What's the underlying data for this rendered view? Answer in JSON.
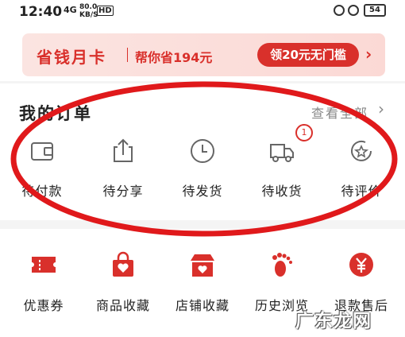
{
  "status_bar": {
    "time": "12:40",
    "network": "4G",
    "speed_value": "80.0",
    "speed_unit": "KB/S",
    "hd": "HD",
    "battery": "54"
  },
  "promo": {
    "title": "省钱月卡",
    "subtitle": "帮你省194元",
    "button": "领20元无门槛",
    "arrow": "›"
  },
  "orders": {
    "title": "我的订单",
    "view_all": "查看全部",
    "items": [
      {
        "label": "待付款",
        "icon": "wallet-icon"
      },
      {
        "label": "待分享",
        "icon": "share-icon"
      },
      {
        "label": "待发货",
        "icon": "clock-icon"
      },
      {
        "label": "待收货",
        "icon": "truck-icon",
        "badge": "1"
      },
      {
        "label": "待评价",
        "icon": "review-icon"
      }
    ]
  },
  "services": [
    {
      "label": "优惠券",
      "icon": "coupon-icon"
    },
    {
      "label": "商品收藏",
      "icon": "bag-heart-icon"
    },
    {
      "label": "店铺收藏",
      "icon": "store-heart-icon"
    },
    {
      "label": "历史浏览",
      "icon": "footprint-icon"
    },
    {
      "label": "退款售后",
      "icon": "refund-icon"
    }
  ],
  "watermark": "广东龙网",
  "colors": {
    "accent": "#d9302b",
    "annotation": "#e0191b"
  }
}
